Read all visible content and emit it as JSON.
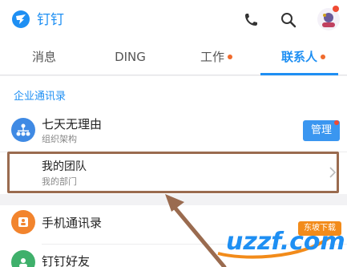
{
  "header": {
    "app_title": "钉钉",
    "icons": [
      "dingtalk-logo",
      "phone-icon",
      "search-icon",
      "avatar"
    ]
  },
  "tabs": [
    {
      "label": "消息",
      "active": false,
      "dot": false
    },
    {
      "label": "DING",
      "active": false,
      "dot": false
    },
    {
      "label": "工作",
      "active": false,
      "dot": true
    },
    {
      "label": "联系人",
      "active": true,
      "dot": true
    }
  ],
  "contacts": {
    "section_label": "企业通讯录",
    "org": {
      "title": "七天无理由",
      "subtitle": "组织架构",
      "manage_label": "管理"
    },
    "team": {
      "title": "我的团队",
      "subtitle": "我的部门"
    },
    "phone_contacts": {
      "title": "手机通讯录"
    },
    "friends": {
      "title": "钉钉好友"
    }
  },
  "watermark": {
    "text": "uzzf.com",
    "badge": "东坡下载"
  },
  "colors": {
    "accent": "#1e8ff3",
    "notification": "#f04b33",
    "highlight": "#9a6b4f",
    "phone_icon_bg": "#f2842d",
    "friend_icon_bg": "#3fb06b"
  }
}
